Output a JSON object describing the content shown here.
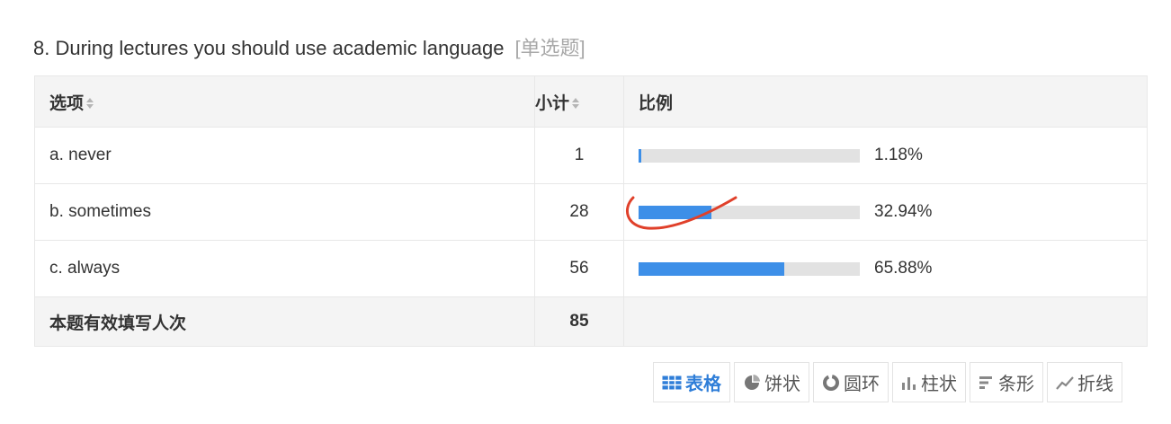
{
  "question": {
    "title": "8. During lectures you should use academic language",
    "type_tag": "[单选题]"
  },
  "table": {
    "headers": {
      "option": "选项",
      "count": "小计",
      "ratio": "比例"
    },
    "rows": [
      {
        "option": "a. never",
        "count": "1",
        "ratio_text": "1.18%",
        "ratio": 1.18
      },
      {
        "option": "b. sometimes",
        "count": "28",
        "ratio_text": "32.94%",
        "ratio": 32.94
      },
      {
        "option": "c. always",
        "count": "56",
        "ratio_text": "65.88%",
        "ratio": 65.88
      }
    ],
    "total": {
      "label": "本题有效填写人次",
      "count": "85"
    }
  },
  "toolbar": {
    "buttons": [
      {
        "label": "表格",
        "icon": "table-icon",
        "active": true
      },
      {
        "label": "饼状",
        "icon": "pie-chart-icon",
        "active": false
      },
      {
        "label": "圆环",
        "icon": "donut-chart-icon",
        "active": false
      },
      {
        "label": "柱状",
        "icon": "column-chart-icon",
        "active": false
      },
      {
        "label": "条形",
        "icon": "bar-chart-icon",
        "active": false
      },
      {
        "label": "折线",
        "icon": "line-chart-icon",
        "active": false
      }
    ]
  },
  "colors": {
    "bar_fill": "#3d8fe8",
    "bar_track": "#e2e2e2",
    "active": "#2f7ed8",
    "annotation": "#e0402a"
  }
}
